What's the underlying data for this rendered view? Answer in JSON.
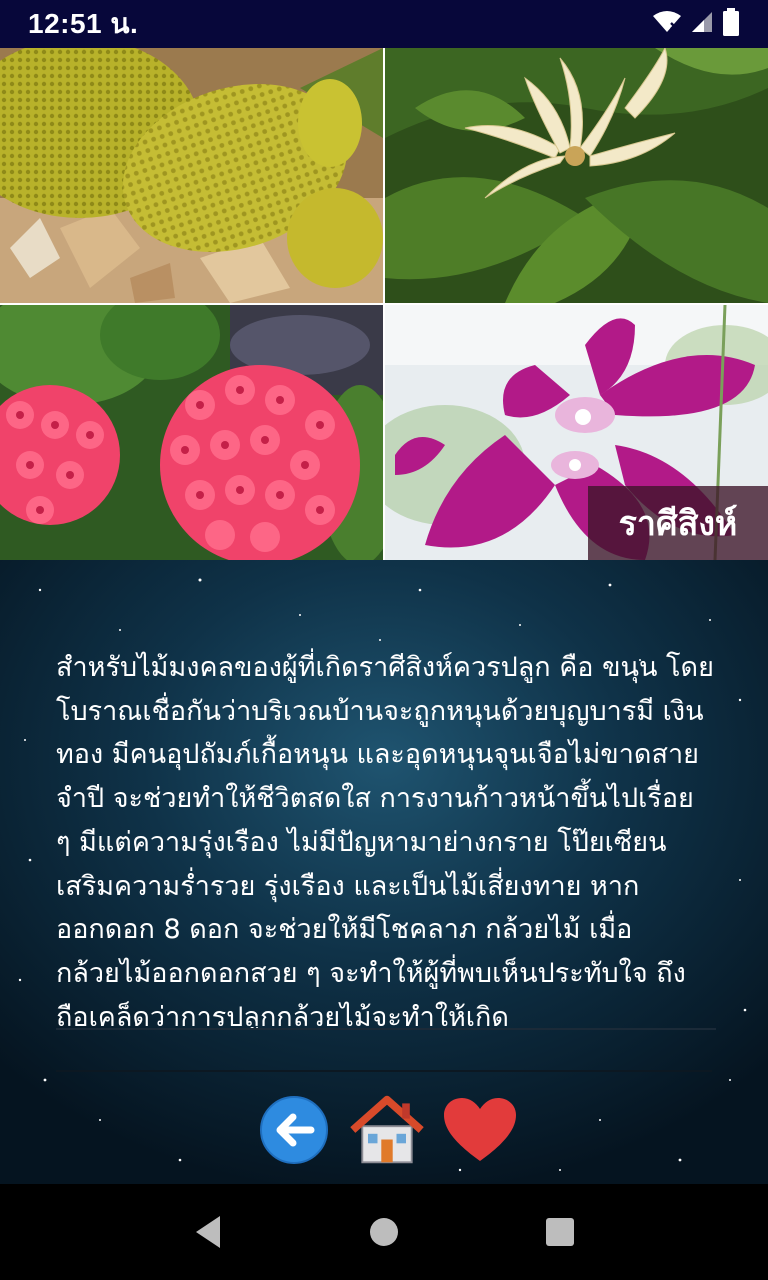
{
  "status_bar": {
    "time": "12:51 น.",
    "icons": [
      "wifi-icon",
      "signal-icon",
      "battery-icon"
    ]
  },
  "collage": {
    "tiles": [
      "jackfruit-photo",
      "champak-flower-photo",
      "crown-of-thorns-photo",
      "orchid-photo"
    ],
    "sign_label": "ราศีสิงห์"
  },
  "article": {
    "text": "สำหรับไม้มงคลของผู้ที่เกิดราศีสิงห์ควรปลูก คือ ขนุน โดยโบราณเชื่อกันว่าบริเวณบ้านจะถูกหนุนด้วยบุญบารมี เงินทอง มีคนอุปถัมภ์เกื้อหนุน และอุดหนุนจุนเจือไม่ขาดสาย จำปี จะช่วยทำให้ชีวิตสดใส การงานก้าวหน้าขึ้นไปเรื่อย ๆ มีแต่ความรุ่งเรือง ไม่มีปัญหามาย่างกราย โป๊ยเซียน เสริมความร่ำรวย รุ่งเรือง และเป็นไม้เสี่ยงทาย หากออกดอก 8 ดอก จะช่วยให้มีโชคลาภ กล้วยไม้ เมื่อกล้วยไม้ออกดอกสวย ๆ จะทำให้ผู้ที่พบเห็นประทับใจ ถึงถือเคล็ดว่าการปลูกกล้วยไม้จะทำให้เกิด"
  },
  "actions": {
    "back": "back-arrow-icon",
    "home": "home-icon",
    "favorite": "heart-icon"
  },
  "nav_bar": {
    "buttons": [
      "nav-back-icon",
      "nav-home-icon",
      "nav-recents-icon"
    ]
  },
  "colors": {
    "status_bar_bg": "#07073a",
    "back_button_blue": "#2e8be0",
    "heart_red": "#e23b3b",
    "space_bg": "#0b2233"
  }
}
